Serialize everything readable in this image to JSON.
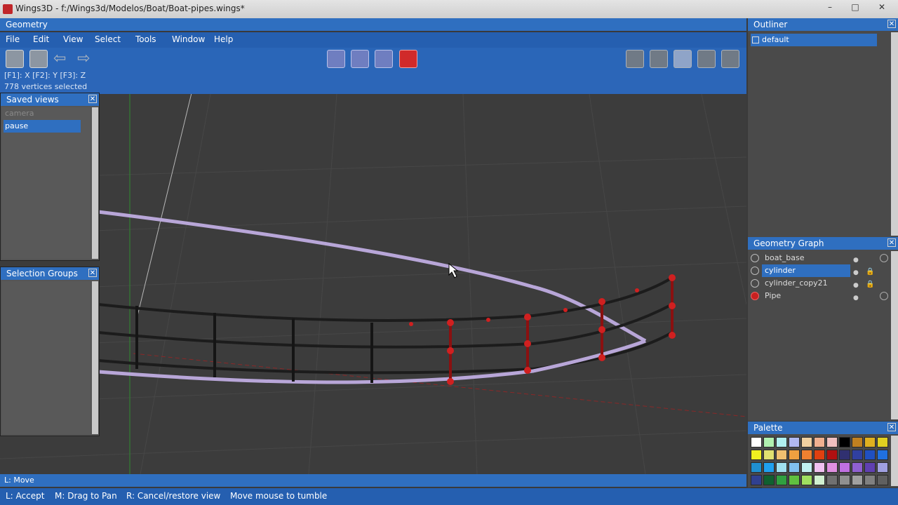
{
  "window": {
    "title": "Wings3D - f:/Wings3d/Modelos/Boat/Boat-pipes.wings*",
    "min": "–",
    "max": "□",
    "close": "✕"
  },
  "geometry_panel": {
    "title": "Geometry"
  },
  "menu": [
    "File",
    "Edit",
    "View",
    "Select",
    "Tools",
    "Window",
    "Help"
  ],
  "info": {
    "keys": "[F1]: X   [F2]: Y   [F3]: Z",
    "selection": "778 vertices selected"
  },
  "saved_views": {
    "title": "Saved views",
    "close": "✕",
    "items": [
      "camera",
      "pause"
    ]
  },
  "selection_groups": {
    "title": "Selection Groups",
    "close": "✕"
  },
  "outliner": {
    "title": "Outliner",
    "close": "✕",
    "items": [
      "default"
    ]
  },
  "geometry_graph": {
    "title": "Geometry Graph",
    "close": "✕",
    "items": [
      {
        "name": "boat_base",
        "locked": false
      },
      {
        "name": "cylinder",
        "locked": true
      },
      {
        "name": "cylinder_copy21",
        "locked": true
      },
      {
        "name": "Pipe",
        "locked": false
      }
    ]
  },
  "palette": {
    "title": "Palette",
    "close": "✕",
    "colors": [
      "#ffffff",
      "#b0f0b0",
      "#b0f0f0",
      "#b0b8f0",
      "#f0d0a0",
      "#f0b090",
      "#f0c0c0",
      "#000000",
      "#c08020",
      "#e0b020",
      "#e0d020",
      "#f0f020",
      "#e0e070",
      "#f0c070",
      "#f0a040",
      "#f08030",
      "#e04010",
      "#b01010",
      "#303070",
      "#3040a0",
      "#2050c0",
      "#2070e0",
      "#2090d0",
      "#20a0f0",
      "#a0e0f0",
      "#80c0f0",
      "#c0f0f0",
      "#f0c0f0",
      "#e090e0",
      "#c070e0",
      "#9060d0",
      "#6040b0",
      "#a0a0e0",
      "#304090",
      "#106030",
      "#30a040",
      "#60c040",
      "#a0e060",
      "#d0f0d0",
      "#707070",
      "#909090",
      "#a0a0a0",
      "#808080",
      "#606060",
      "#b0b0b0"
    ]
  },
  "mode": "L: Move",
  "help": [
    "L: Accept",
    "M: Drag to Pan",
    "R: Cancel/restore view",
    "Move mouse to tumble"
  ]
}
